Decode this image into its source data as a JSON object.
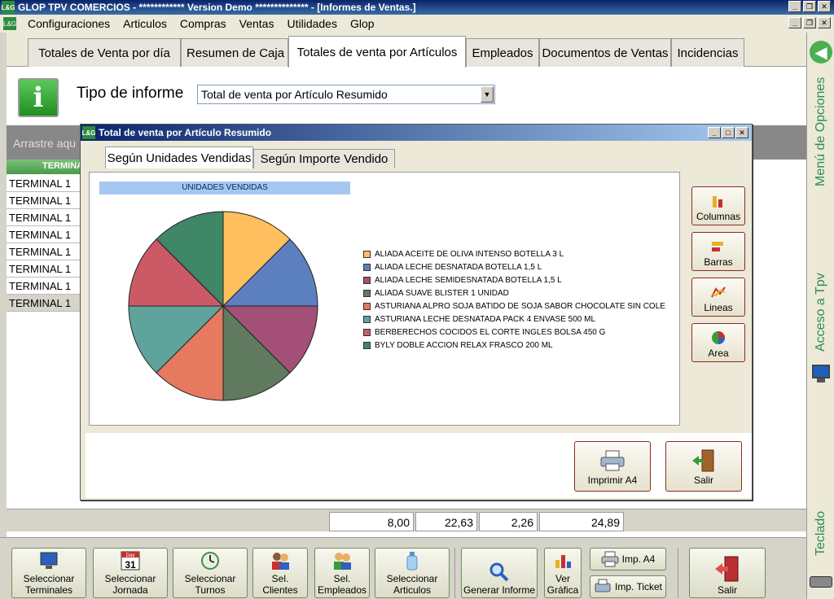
{
  "window": {
    "title": "GLOP TPV COMERCIOS - ************ Version Demo ************** - [Informes de Ventas.]"
  },
  "menu": [
    "Configuraciones",
    "Articulos",
    "Compras",
    "Ventas",
    "Utilidades",
    "Glop"
  ],
  "tabs": [
    "Totales de Venta por día",
    "Resumen de Caja",
    "Totales de venta por Artículos",
    "Empleados",
    "Documentos de Ventas",
    "Incidencias"
  ],
  "report": {
    "label": "Tipo de informe",
    "selected": "Total de venta por Artículo Resumido"
  },
  "grid": {
    "group_hint": "Arrastre aqu",
    "header": "TERMINA",
    "rows": [
      "TERMINAL 1",
      "TERMINAL 1",
      "TERMINAL 1",
      "TERMINAL 1",
      "TERMINAL 1",
      "TERMINAL 1",
      "TERMINAL 1",
      "TERMINAL 1"
    ]
  },
  "totals": [
    "8,00",
    "22,63",
    "2,26",
    "24,89"
  ],
  "dialog": {
    "title": "Total de venta por Artículo Resumido",
    "tabs": [
      "Según Unidades Vendidas",
      "Según Importe Vendido"
    ],
    "chart_buttons": [
      "Columnas",
      "Barras",
      "Lineas",
      "Area"
    ],
    "print_label": "Imprimir A4",
    "exit_label": "Salir"
  },
  "chart_data": {
    "type": "pie",
    "title": "UNIDADES VENDIDAS",
    "categories": [
      "ALIADA ACEITE DE OLIVA INTENSO BOTELLA 3 L",
      "ALIADA LECHE DESNATADA BOTELLA 1,5 L",
      "ALIADA LECHE SEMIDESNATADA BOTELLA 1,5 L",
      "ALIADA SUAVE BLISTER 1 UNIDAD",
      "ASTURIANA ALPRO SOJA BATIDO DE SOJA SABOR CHOCOLATE SIN COLE",
      "ASTURIANA LECHE DESNATADA PACK 4 ENVASE 500 ML",
      "BERBERECHOS COCIDOS EL CORTE INGLES BOLSA 450 G",
      "BYLY DOBLE ACCION RELAX FRASCO 200 ML"
    ],
    "values": [
      1,
      1,
      1,
      1,
      1,
      1,
      1,
      1
    ],
    "colors": [
      "#ffbf5f",
      "#5b7fbf",
      "#a34f78",
      "#5f7a5f",
      "#e67a5f",
      "#5fa39c",
      "#cc5a66",
      "#3f8766"
    ]
  },
  "sidebar": {
    "menu_label": "Menú de Opciones",
    "tpv_label": "Acceso a Tpv",
    "keyboard_label": "Teclado"
  },
  "toolbar": {
    "sel_terminales": "Seleccionar Terminales",
    "sel_jornada": "Seleccionar Jornada",
    "sel_turnos": "Seleccionar Turnos",
    "sel_clientes": "Sel. Clientes",
    "sel_empleados": "Sel. Empleados",
    "sel_articulos": "Seleccionar Articulos",
    "generar": "Generar Informe",
    "ver_grafica": "Ver Gráfica",
    "imp_a4": "Imp. A4",
    "imp_ticket": "Imp. Ticket",
    "salir": "Salir",
    "calendar_day": "31",
    "calendar_month": "Day"
  }
}
